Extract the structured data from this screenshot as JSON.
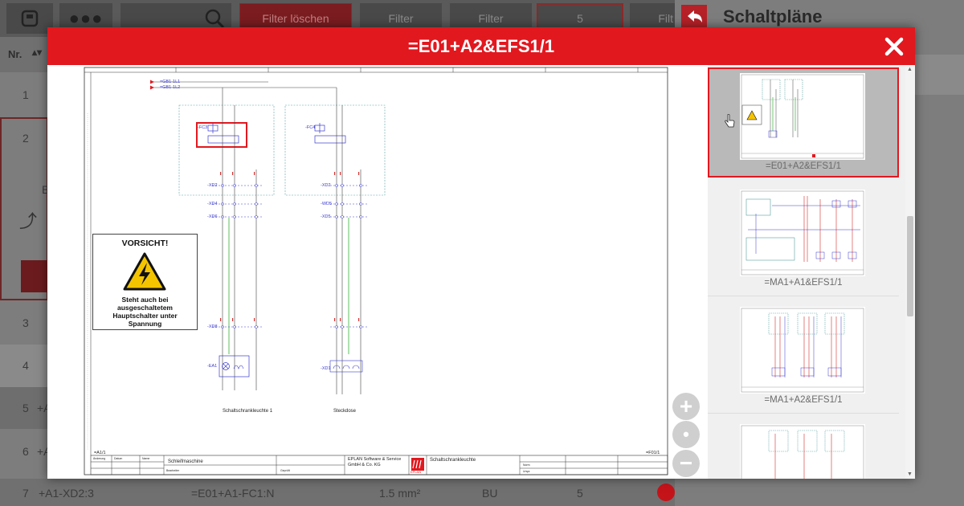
{
  "background": {
    "toolbar": {
      "filter_clear_label": "Filter löschen",
      "filter_label_1": "Filter",
      "filter_label_2": "Filter",
      "count_label": "5",
      "filter_label_3": "Filt"
    },
    "table": {
      "header_nr": "Nr.",
      "rows": [
        "1",
        "2",
        "3",
        "4",
        "5",
        "6",
        "7"
      ],
      "row2_letter": "B",
      "row5_prefix": "+A",
      "row6_prefix": "+A",
      "last_row": {
        "nr": "7",
        "source": "+A1-XD2:3",
        "target": "=E01+A1-FC1:N",
        "cross_section": "1.5 mm²",
        "color": "BU",
        "count": "5"
      }
    },
    "panel_title": "Schaltpläne"
  },
  "modal": {
    "title": "=E01+A2&EFS1/1",
    "close_label": "×",
    "zoom_in": "+",
    "zoom_reset": "•",
    "zoom_out": "−"
  },
  "schematic": {
    "warning_title": "VORSICHT!",
    "warning_text": "Steht auch bei ausgeschaltetem Hauptschalter unter Spannung",
    "label_left": "Schaltschrankleuchte 1",
    "label_right": "Steckdose",
    "bus_label_1": "=GB1-1L1",
    "bus_label_2": "=GB1-1L2",
    "dev_fc3": "-FC3",
    "dev_fc4": "-FC4",
    "xd2a": "-XD2",
    "xd4": "-XD4",
    "xd6": "-XD6",
    "xd8": "-XD8",
    "ea1": "-EA1",
    "xd2b": "-XD2",
    "wd5": "-WD5",
    "xd5": "-XD5",
    "xd1": "-XD1",
    "page_ref_left": "=A1/1",
    "page_ref_right": "=F01/1",
    "tb_project": "Schleifmaschine",
    "tb_company_1": "EPLAN Software & Service",
    "tb_company_2": "GmbH & Co. KG",
    "tb_sheet_title": "Schaltschrankleuchte",
    "tb_logo": "EPLAN",
    "tb_fields": [
      "Änderung",
      "Datum",
      "Name",
      "Bearbeiter",
      "Geprüft",
      "Norm",
      "Urspr."
    ]
  },
  "thumbnails": [
    {
      "label": "=E01+A2&EFS1/1",
      "selected": true
    },
    {
      "label": "=MA1+A1&EFS1/1",
      "selected": false
    },
    {
      "label": "=MA1+A2&EFS1/1",
      "selected": false
    },
    {
      "label": "",
      "selected": false
    }
  ],
  "colors": {
    "accent": "#e2181f",
    "wire_blue": "#3a3acf",
    "wire_green": "#35b035",
    "wire_red": "#d23030",
    "box_teal": "#5aa0a0"
  }
}
